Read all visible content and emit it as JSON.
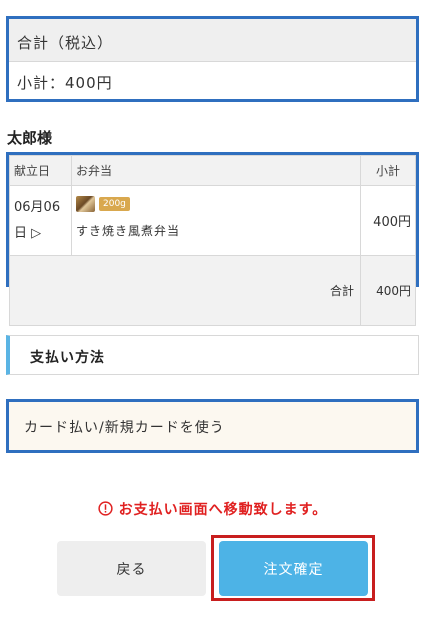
{
  "summary": {
    "header": "合計（税込）",
    "subtotal_label": "小計：400円"
  },
  "customer": {
    "name": "太郎様"
  },
  "order": {
    "headers": {
      "date": "献立日",
      "bento": "お弁当",
      "subtotal": "小計"
    },
    "rows": [
      {
        "date_line1": "06月06",
        "date_line2": "日 ▷",
        "gram": "200g",
        "name": "すき焼き風煮弁当",
        "price": "400円"
      }
    ],
    "total_label": "合計",
    "total_amount": "400円"
  },
  "payment": {
    "heading": "支払い方法",
    "method": "カード払い/新規カードを使う"
  },
  "notice": {
    "icon": "!",
    "text": "お支払い画面へ移動致します。"
  },
  "buttons": {
    "back": "戻る",
    "confirm": "注文確定"
  },
  "colors": {
    "accent_blue": "#2f6fbf",
    "button_blue": "#4db3e6",
    "warning_red": "#e02020"
  }
}
